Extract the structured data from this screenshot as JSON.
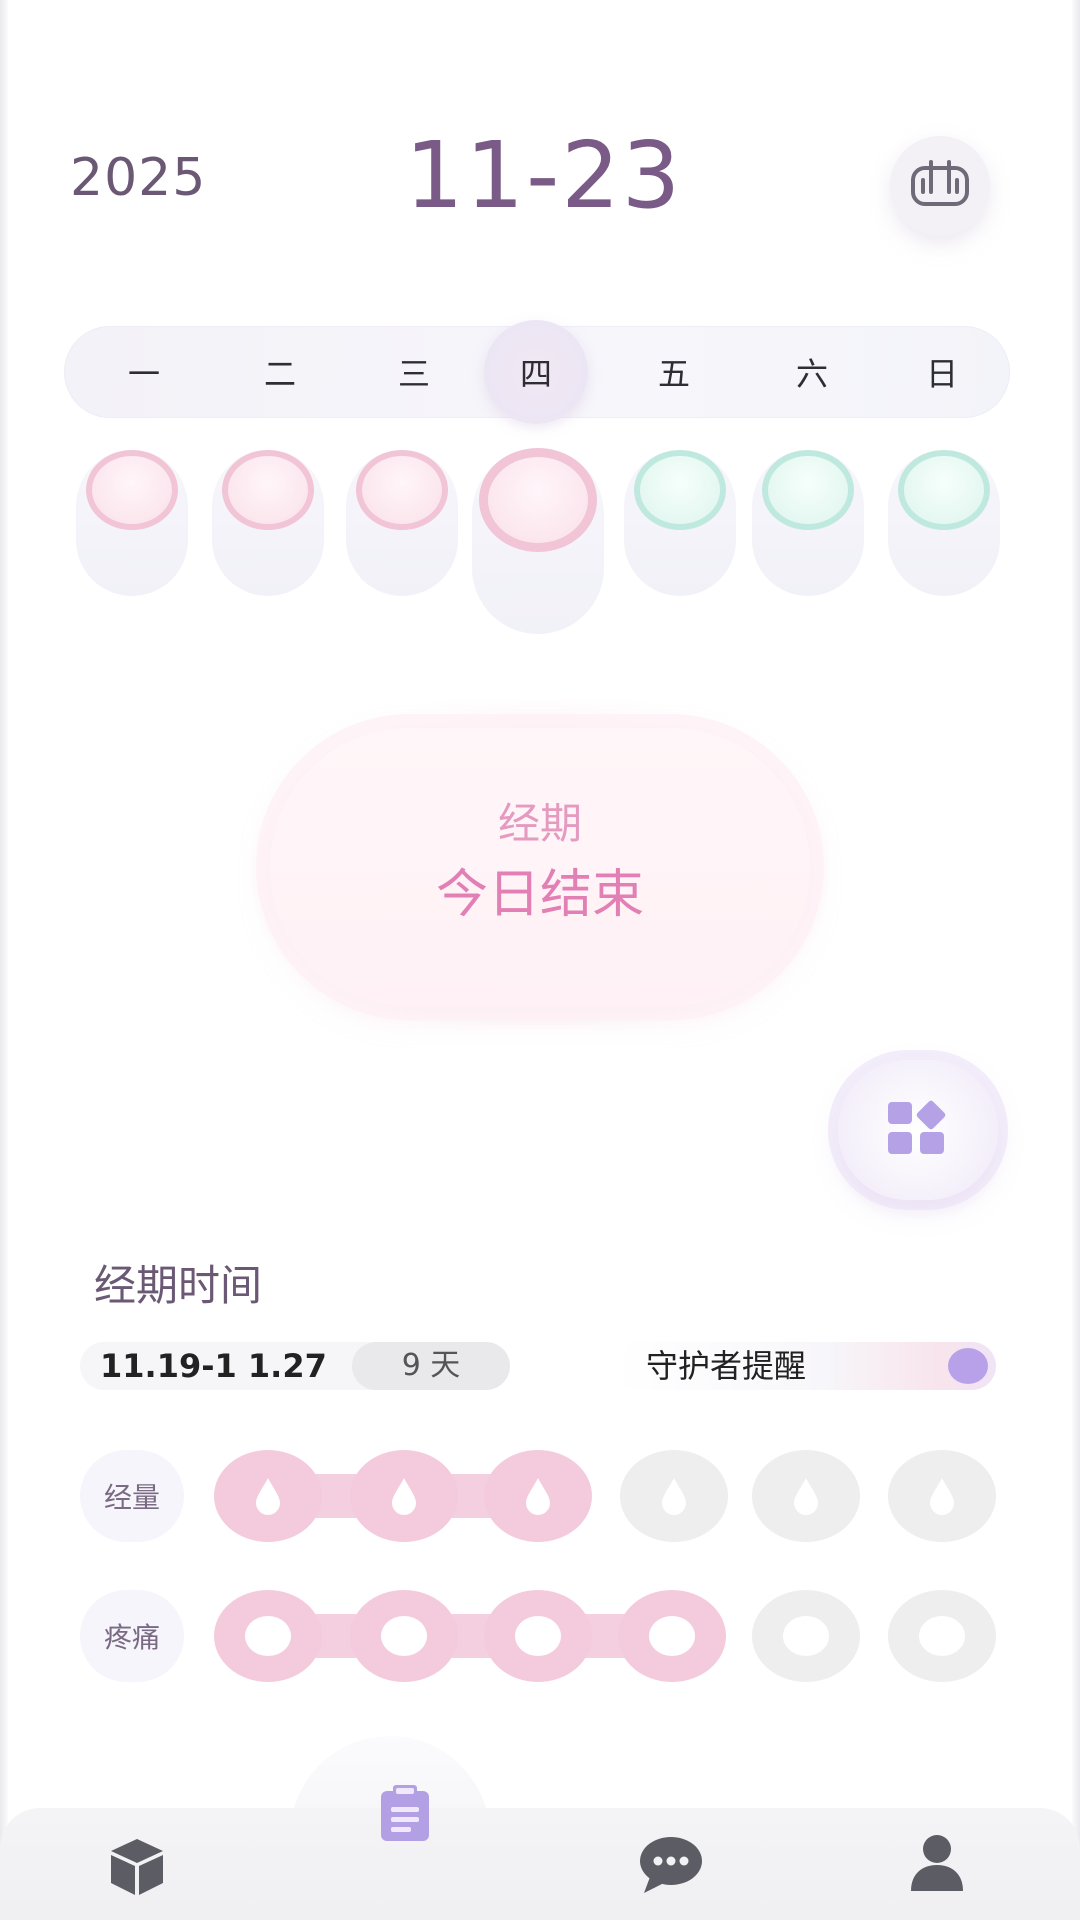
{
  "header": {
    "year": "2025",
    "date": "11-23",
    "stats_icon": "bar-chart-icon"
  },
  "week": {
    "days": [
      "一",
      "二",
      "三",
      "四",
      "五",
      "六",
      "日"
    ],
    "today_index": 3,
    "markers": [
      "period",
      "period",
      "period",
      "period",
      "safe",
      "safe",
      "safe"
    ]
  },
  "status_card": {
    "subtitle": "经期",
    "title": "今日结束"
  },
  "widget": {
    "icon": "grid-shapes-icon"
  },
  "period": {
    "title": "经期时间",
    "range": "11.19-1 1.27",
    "days": "9 天",
    "guardian_label": "守护者提醒",
    "guardian_on": true,
    "flow": {
      "label": "经量",
      "level": 3,
      "max": 6
    },
    "pain": {
      "label": "疼痛",
      "level": 4,
      "max": 6
    }
  },
  "colors": {
    "accent": "#b9a1ea",
    "pink": "#f4cadd",
    "mint": "#bfe9de",
    "title": "#7a5a86"
  },
  "nav": {
    "items": [
      {
        "icon": "cube-icon"
      },
      {
        "icon": "clipboard-icon",
        "active": true
      },
      {
        "icon": "chat-bubble-icon"
      },
      {
        "icon": "user-icon"
      }
    ]
  }
}
